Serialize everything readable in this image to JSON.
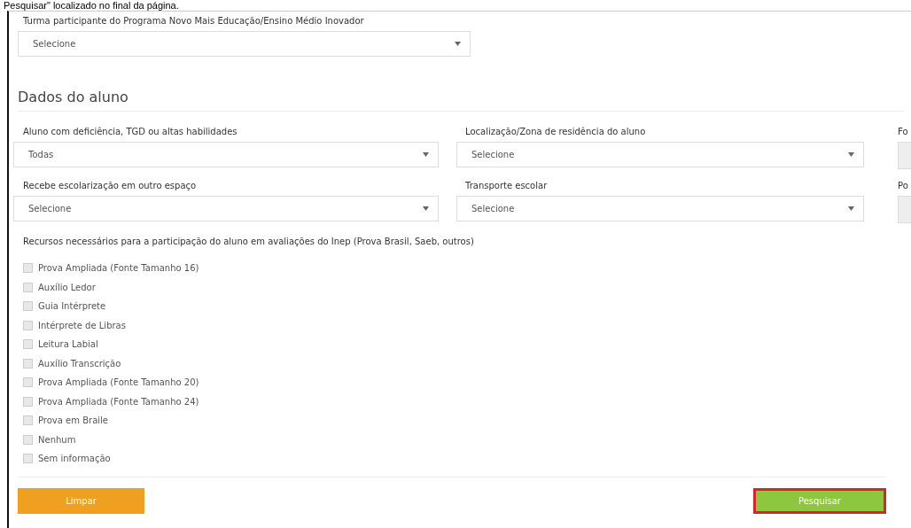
{
  "caption": "Pesquisar\" localizado no final da página.",
  "program_field": {
    "label": "Turma participante do Programa Novo Mais Educação/Ensino Médio Inovador",
    "value": "Selecione"
  },
  "section_title": "Dados do aluno",
  "fields": [
    {
      "label": "Aluno com deficiência, TGD ou altas habilidades",
      "value": "Todas",
      "kind": "select"
    },
    {
      "label": "Localização/Zona de residência do aluno",
      "value": "Selecione",
      "kind": "select"
    },
    {
      "label": "Fo",
      "kind": "cut"
    },
    {
      "label": "Recebe escolarização em outro espaço",
      "value": "Selecione",
      "kind": "select"
    },
    {
      "label": "Transporte escolar",
      "value": "Selecione",
      "kind": "select"
    },
    {
      "label": "Po",
      "kind": "cut"
    }
  ],
  "resources": {
    "label": "Recursos necessários para a participação do aluno em avaliações do Inep (Prova Brasil, Saeb, outros)",
    "options": [
      {
        "label": "Prova Ampliada (Fonte Tamanho 16)",
        "checked": false
      },
      {
        "label": "Auxílio Ledor",
        "checked": false
      },
      {
        "label": "Guia Intérprete",
        "checked": false
      },
      {
        "label": "Intérprete de Libras",
        "checked": false
      },
      {
        "label": "Leitura Labial",
        "checked": false
      },
      {
        "label": "Auxílio Transcrição",
        "checked": false
      },
      {
        "label": "Prova Ampliada (Fonte Tamanho 20)",
        "checked": false
      },
      {
        "label": "Prova Ampliada (Fonte Tamanho 24)",
        "checked": false
      },
      {
        "label": "Prova em Braile",
        "checked": false
      },
      {
        "label": "Nenhum",
        "checked": false
      },
      {
        "label": "Sem informação",
        "checked": false
      }
    ]
  },
  "buttons": [
    {
      "label": "Limpar",
      "kind": "clear",
      "highlighted": false
    },
    {
      "label": "Pesquisar",
      "kind": "search",
      "highlighted": true
    }
  ]
}
